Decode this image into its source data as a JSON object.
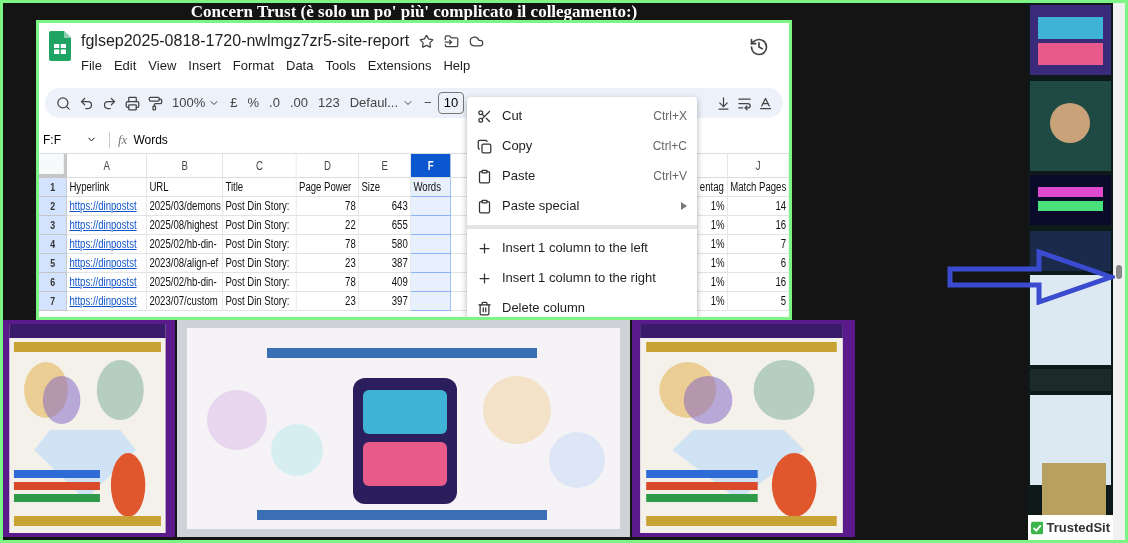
{
  "caption": "Concern Trust (è solo un po' più' complicato il collegamento:)",
  "spreadsheet": {
    "title": "fglsep2025-0818-1720-nwlmgz7zr5-site-report",
    "menu": [
      "File",
      "Edit",
      "View",
      "Insert",
      "Format",
      "Data",
      "Tools",
      "Extensions",
      "Help"
    ],
    "toolbar": {
      "zoom": "100%",
      "currency": "£",
      "percent": "%",
      "decrease_decimal": ".0",
      "increase_decimal": ".00",
      "number_format": "123",
      "font": "Defaul...",
      "font_size_decrease": "−",
      "font_size": "10"
    },
    "name_box": "F:F",
    "formula_label": "fx",
    "formula": "Words",
    "columns": [
      {
        "label": "A",
        "selected": false
      },
      {
        "label": "B",
        "selected": false
      },
      {
        "label": "C",
        "selected": false
      },
      {
        "label": "D",
        "selected": false
      },
      {
        "label": "E",
        "selected": false
      },
      {
        "label": "F",
        "selected": true
      },
      {
        "label": "J",
        "selected": false
      }
    ],
    "rows": [
      {
        "number": "1",
        "kind": "header",
        "hyperlink": "Hyperlink",
        "url": "URL",
        "title": "Title",
        "page_power": "Page Power",
        "size": "Size",
        "words": "Words",
        "percentage": "entag",
        "match_pages": "Match Pages"
      },
      {
        "number": "2",
        "kind": "data",
        "hyperlink": "https://dinpostst",
        "url": "2025/03/demons",
        "title": "Post Din Story:",
        "page_power": "78",
        "size": "643",
        "percentage": "1%",
        "match_pages": "14"
      },
      {
        "number": "3",
        "kind": "data",
        "hyperlink": "https://dinpostst",
        "url": "2025/08/highest",
        "title": "Post Din Story:",
        "page_power": "22",
        "size": "655",
        "percentage": "1%",
        "match_pages": "16"
      },
      {
        "number": "4",
        "kind": "data",
        "hyperlink": "https://dinpostst",
        "url": "2025/02/hb-din-",
        "title": "Post Din Story:",
        "page_power": "78",
        "size": "580",
        "percentage": "1%",
        "match_pages": "7"
      },
      {
        "number": "5",
        "kind": "data",
        "hyperlink": "https://dinpostst",
        "url": "2023/08/align-ef",
        "title": "Post Din Story:",
        "page_power": "23",
        "size": "387",
        "percentage": "1%",
        "match_pages": "6"
      },
      {
        "number": "6",
        "kind": "data",
        "hyperlink": "https://dinpostst",
        "url": "2025/02/hb-din-",
        "title": "Post Din Story:",
        "page_power": "78",
        "size": "409",
        "percentage": "1%",
        "match_pages": "16"
      },
      {
        "number": "7",
        "kind": "data",
        "hyperlink": "https://dinpostst",
        "url": "2023/07/custom",
        "title": "Post Din Story:",
        "page_power": "23",
        "size": "397",
        "percentage": "1%",
        "match_pages": "5"
      }
    ],
    "context_menu": [
      [
        {
          "kind": "cut",
          "label": "Cut",
          "shortcut": "Ctrl+X",
          "submenu": false
        },
        {
          "kind": "copy",
          "label": "Copy",
          "shortcut": "Ctrl+C",
          "submenu": false
        },
        {
          "kind": "paste",
          "label": "Paste",
          "shortcut": "Ctrl+V",
          "submenu": false
        },
        {
          "kind": "paste",
          "label": "Paste special",
          "submenu": true
        }
      ],
      [
        {
          "kind": "insert",
          "label": "Insert 1 column to the left",
          "submenu": false
        },
        {
          "kind": "insert",
          "label": "Insert 1 column to the right",
          "submenu": false
        },
        {
          "kind": "delete",
          "label": "Delete column",
          "submenu": false
        }
      ]
    ]
  },
  "trust_badge": "TrustedSit"
}
